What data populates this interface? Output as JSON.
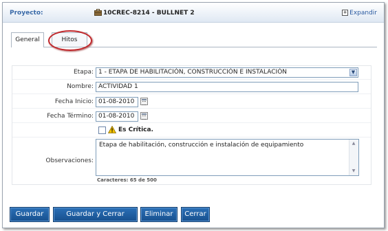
{
  "header": {
    "project_label": "Proyecto:",
    "project_name": "10CREC-8214 - BULLNET 2",
    "expand_label": "Expandir"
  },
  "tabs": [
    {
      "label": "General",
      "active": true
    },
    {
      "label": "Hitos",
      "active": false
    }
  ],
  "form": {
    "etapa_label": "Etapa:",
    "etapa_value": "1 - ETAPA DE HABILITACIÓN, CONSTRUCCIÓN E INSTALACIÓN",
    "nombre_label": "Nombre:",
    "nombre_value": "ACTIVIDAD 1",
    "fecha_inicio_label": "Fecha Inicio:",
    "fecha_inicio_value": "01-08-2010",
    "fecha_termino_label": "Fecha Término:",
    "fecha_termino_value": "01-08-2010",
    "critica_label": "Es Crítica.",
    "critica_checked": false,
    "observaciones_label": "Observaciones:",
    "observaciones_value": "Etapa de habilitación, construcción e instalación de equipamiento",
    "counter": "Caracteres: 65 de 500"
  },
  "buttons": {
    "guardar": "Guardar",
    "guardar_cerrar": "Guardar y Cerrar",
    "eliminar": "Eliminar",
    "cerrar": "Cerrar"
  },
  "colors": {
    "accent": "#1f5fa4",
    "highlight": "#c0262a",
    "header_label": "#3a6aa8"
  }
}
